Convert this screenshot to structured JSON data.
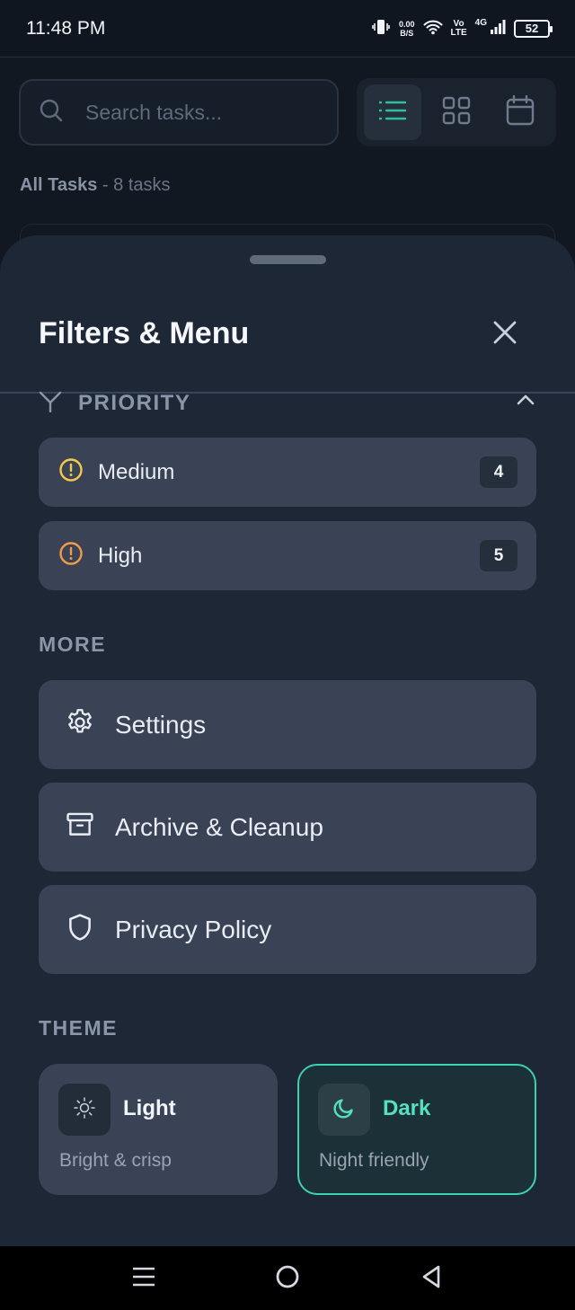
{
  "status_bar": {
    "time": "11:48 PM",
    "net_speed_value": "0.00",
    "net_speed_unit": "B/S",
    "volte_top": "Vo",
    "volte_bottom": "LTE",
    "network_type": "4G",
    "battery": "52"
  },
  "search": {
    "placeholder": "Search tasks..."
  },
  "view_toggle": {
    "active": "list",
    "icons": [
      "list-icon",
      "grid-icon",
      "calendar-icon"
    ],
    "accent": "#2fbf9f"
  },
  "task_header": {
    "title": "All Tasks",
    "separator": "-",
    "count": "8 tasks"
  },
  "sheet": {
    "title": "Filters & Menu",
    "priority": {
      "label": "PRIORITY",
      "items": [
        {
          "label": "Medium",
          "count": "4",
          "color": "#f2c94c",
          "icon": "alert-circle-icon"
        },
        {
          "label": "High",
          "count": "5",
          "color": "#f2994a",
          "icon": "alert-circle-icon"
        }
      ]
    },
    "more": {
      "label": "MORE",
      "items": [
        {
          "label": "Settings",
          "icon": "gear-icon"
        },
        {
          "label": "Archive & Cleanup",
          "icon": "archive-icon"
        },
        {
          "label": "Privacy Policy",
          "icon": "shield-icon"
        }
      ]
    },
    "theme": {
      "label": "THEME",
      "options": [
        {
          "title": "Light",
          "subtitle": "Bright & crisp",
          "icon": "sun-icon",
          "selected": false
        },
        {
          "title": "Dark",
          "subtitle": "Night friendly",
          "icon": "moon-icon",
          "selected": true
        }
      ],
      "accent": "#3dd1b0"
    }
  },
  "nav_bar": {
    "buttons": [
      "recent-apps-icon",
      "home-icon",
      "back-icon"
    ]
  }
}
